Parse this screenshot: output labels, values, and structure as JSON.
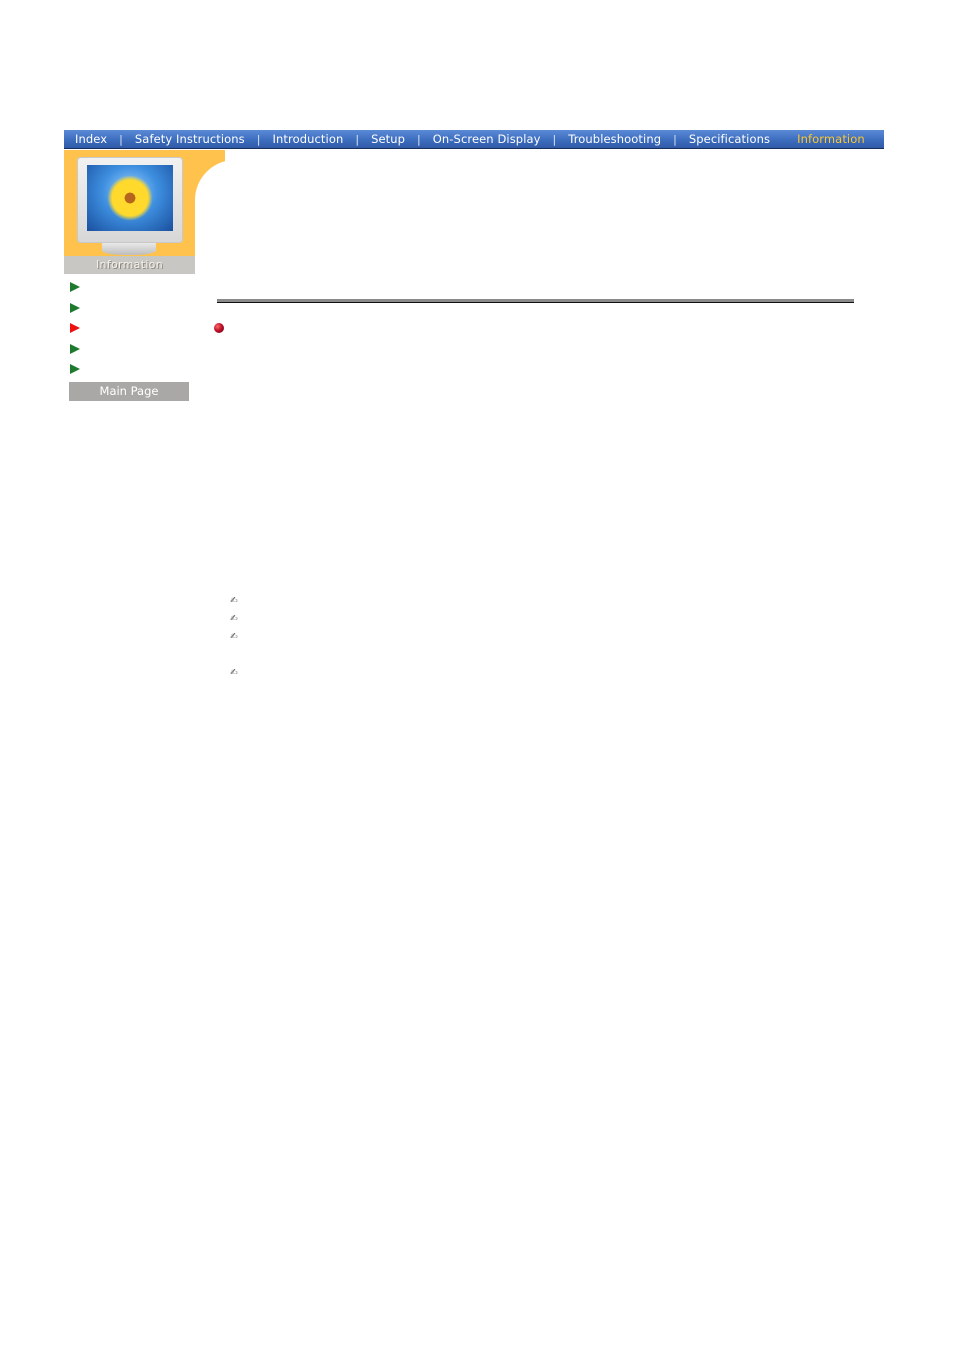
{
  "nav": {
    "items": [
      {
        "label": "Index",
        "active": false
      },
      {
        "label": "Safety Instructions",
        "active": false
      },
      {
        "label": "Introduction",
        "active": false
      },
      {
        "label": "Setup",
        "active": false
      },
      {
        "label": "On-Screen Display",
        "active": false
      },
      {
        "label": "Troubleshooting",
        "active": false
      },
      {
        "label": "Specifications",
        "active": false
      },
      {
        "label": "Information",
        "active": true
      }
    ],
    "separator": "|",
    "active_color": "#ffc72c"
  },
  "sidebar": {
    "hero_label": "Information",
    "items": [
      {
        "icon": "green-arrow-icon",
        "current": false
      },
      {
        "icon": "green-arrow-icon",
        "current": false
      },
      {
        "icon": "red-arrow-icon",
        "current": true
      },
      {
        "icon": "green-arrow-icon",
        "current": false
      },
      {
        "icon": "green-arrow-icon",
        "current": false
      }
    ],
    "main_page_label": "Main Page"
  },
  "content": {
    "bullet_icon": "red-ball-icon",
    "notes": [
      {
        "icon": "pencil-note-icon"
      },
      {
        "icon": "pencil-note-icon"
      },
      {
        "icon": "pencil-note-icon"
      },
      {
        "icon": "pencil-note-icon"
      }
    ],
    "note_glyph": "✍"
  }
}
